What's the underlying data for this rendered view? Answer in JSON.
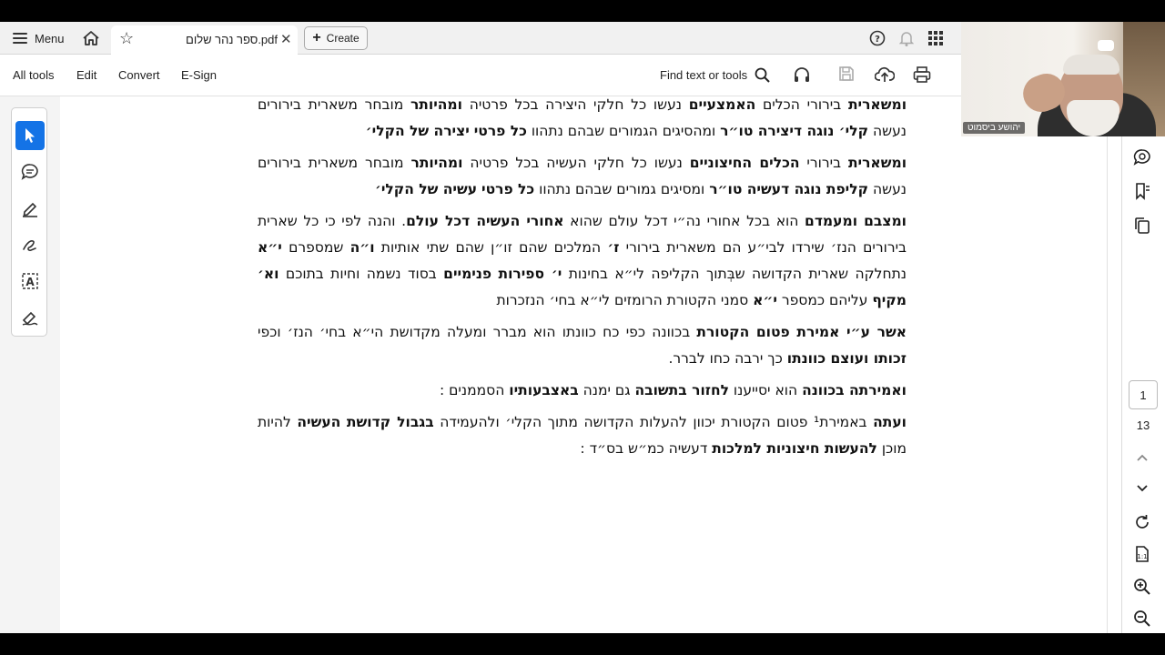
{
  "tabbar": {
    "menu_label": "Menu",
    "doc_tab_title": "ספר נהר שלום.pdf",
    "create_label": "Create"
  },
  "toolbar": {
    "all_tools": "All tools",
    "edit": "Edit",
    "convert": "Convert",
    "esign": "E-Sign",
    "find_label": "Find text or tools"
  },
  "document": {
    "paragraphs": [
      {
        "lines": [
          [
            [
              "b",
              "ומשארית"
            ],
            [
              "",
              " בירורי הכלים "
            ],
            [
              "b",
              "האמצעיים"
            ],
            [
              "",
              " נעשו כל חלקי היצירה בכל פרטיה "
            ],
            [
              "b",
              "ומהיותר"
            ],
            [
              "",
              " מובחר"
            ]
          ],
          [
            [
              "",
              "משארית בירורים נעשה "
            ],
            [
              "b",
              "קלי׳ נוגה דיצירה טו״ר"
            ],
            [
              "",
              " ומהסיגים הגמורים שבהם נתהוו "
            ],
            [
              "b",
              "כל פרטי"
            ]
          ],
          [
            [
              "b",
              "יצירה של הקלי׳"
            ]
          ]
        ]
      },
      {
        "lines": [
          [
            [
              "b",
              "ומשארית"
            ],
            [
              "",
              " בירורי "
            ],
            [
              "b",
              "הכלים החיצוניים"
            ],
            [
              "",
              " נעשו כל חלקי העשיה בכל פרטיה "
            ],
            [
              "b",
              "ומהיותר"
            ],
            [
              "",
              " מובחר"
            ]
          ],
          [
            [
              "",
              "משארית בירורים נעשה "
            ],
            [
              "b",
              "קליפת נוגה דעשיה טו״ר"
            ],
            [
              "",
              " ומסיגים גמורים שבהם נתהוו "
            ],
            [
              "b",
              "כל פרטי"
            ]
          ],
          [
            [
              "b",
              "עשיה של הקלי׳"
            ]
          ]
        ]
      },
      {
        "lines": [
          [
            [
              "b",
              "ומצבם ומעמדם"
            ],
            [
              "",
              " הוא בכל אחורי נה״י דכל עולם שהוא "
            ],
            [
              "b",
              "אחורי העשיה דכל עולם"
            ],
            [
              "",
              ". והנה לפי כי"
            ]
          ],
          [
            [
              "",
              "כל שארית בירורים הנז׳ שירדו לבי״ע הם משארית בירורי "
            ],
            [
              "b",
              "ז׳"
            ],
            [
              "",
              " המלכים שהם זו״ן שהם שתי"
            ]
          ],
          [
            [
              "",
              "אותיות "
            ],
            [
              "b",
              "ו״ה"
            ],
            [
              "",
              " שמספרם "
            ],
            [
              "b",
              "י״א"
            ],
            [
              "",
              " נתחלקה שארית הקדושה שבְּתוך הקליפה לי״א בחינות "
            ],
            [
              "b",
              "י׳ ספירות"
            ]
          ],
          [
            [
              "b",
              "פנימיים"
            ],
            [
              "",
              " בסוד נשמה וחיות בתוכם "
            ],
            [
              "b",
              "וא׳ מקיף"
            ],
            [
              "",
              " עליהם כמספר "
            ],
            [
              "b",
              "י״א"
            ],
            [
              "",
              " סמני הקטורת הרומזים לי״א"
            ]
          ],
          [
            [
              "",
              "בחי׳ הנזכרות"
            ]
          ]
        ]
      },
      {
        "lines": [
          [
            [
              "b",
              "אשר ע״י אמירת פטום הקטורת"
            ],
            [
              "",
              " בכוונה כפי כח כוונתו הוא מברר ומעלה מקדושת הי״א בחי׳"
            ]
          ],
          [
            [
              "",
              "הנז׳ וכפי "
            ],
            [
              "b",
              "זכותו ועוצם כוונתו"
            ],
            [
              "",
              " כך ירבה כחו לברר."
            ]
          ]
        ]
      },
      {
        "lines": [
          [
            [
              "b",
              "ואמירתה בכוונה"
            ],
            [
              "",
              " הוא יסייענו "
            ],
            [
              "b",
              "לחזור בתשובה"
            ],
            [
              "",
              " גם ימנה "
            ],
            [
              "b",
              "באצבעותיו"
            ],
            [
              "",
              " הסממנים :"
            ]
          ]
        ]
      },
      {
        "lines": [
          [
            [
              "b",
              "ועתה"
            ],
            [
              "",
              " באמירת¹ פטום הקטורת יכוון להעלות הקדושה מתוך הקלי׳ ולהעמידה "
            ],
            [
              "b",
              "בגבול קדושת"
            ]
          ],
          [
            [
              "b",
              "העשיה"
            ],
            [
              "",
              " להיות מוכן "
            ],
            [
              "b",
              "להעשות חיצוניות למלכות"
            ],
            [
              "",
              " דעשיה כמ״ש בס״ד :"
            ]
          ]
        ]
      }
    ]
  },
  "navigation": {
    "current_page": "1",
    "total_pages": "13"
  },
  "video": {
    "participant_name": "יהושע ביסמוט"
  },
  "colors": {
    "accent": "#1473e6",
    "background": "#f4f4f4",
    "page": "#ffffff"
  }
}
